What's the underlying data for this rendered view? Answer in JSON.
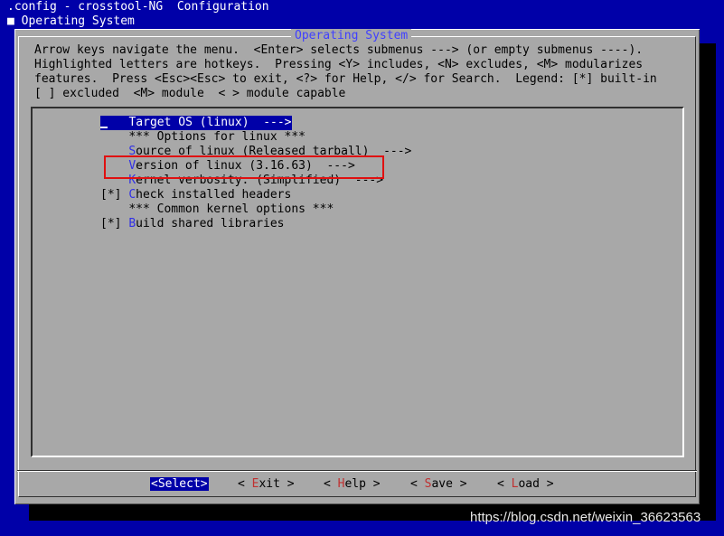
{
  "header": {
    "line1": ".config - crosstool-NG  Configuration",
    "bullet": "■",
    "line2": " Operating System"
  },
  "dialog": {
    "title": "Operating System",
    "help": [
      "Arrow keys navigate the menu.  <Enter> selects submenus ---> (or empty submenus ----).",
      "Highlighted letters are hotkeys.  Pressing <Y> includes, <N> excludes, <M> modularizes",
      "features.  Press <Esc><Esc> to exit, <?> for Help, </> for Search.  Legend: [*] built-in",
      "[ ] excluded  <M> module  < > module capable"
    ]
  },
  "menu": {
    "items": [
      {
        "prefix": "",
        "hot": "",
        "rest": "Target OS (linux)  --->"
      },
      {
        "prefix": "    ",
        "hot": "",
        "rest": "*** Options for linux ***"
      },
      {
        "prefix": "    ",
        "hot": "S",
        "rest": "ource of linux (Released tarball)  --->"
      },
      {
        "prefix": "    ",
        "hot": "V",
        "rest": "ersion of linux (3.16.63)  --->"
      },
      {
        "prefix": "    ",
        "hot": "K",
        "rest": "ernel verbosity: (Simplified)  --->"
      },
      {
        "prefix": "[*] ",
        "hot": "C",
        "rest": "heck installed headers"
      },
      {
        "prefix": "    ",
        "hot": "",
        "rest": "*** Common kernel options ***"
      },
      {
        "prefix": "[*] ",
        "hot": "B",
        "rest": "uild shared libraries"
      }
    ]
  },
  "buttons": {
    "select": "<Select>",
    "exit": {
      "open": "< ",
      "hot": "E",
      "rest": "xit",
      "close": " >"
    },
    "help": {
      "open": "< ",
      "hot": "H",
      "rest": "elp",
      "close": " >"
    },
    "save": {
      "open": "< ",
      "hot": "S",
      "rest": "ave",
      "close": " >"
    },
    "load": {
      "open": "< ",
      "hot": "L",
      "rest": "oad",
      "close": " >"
    }
  },
  "watermark": "https://blog.csdn.net/weixin_36623563",
  "colors": {
    "background": "#0000a8",
    "dialog": "#a8a8a8",
    "hotkey": "#3030e8",
    "highlight_box": "#e01010"
  }
}
